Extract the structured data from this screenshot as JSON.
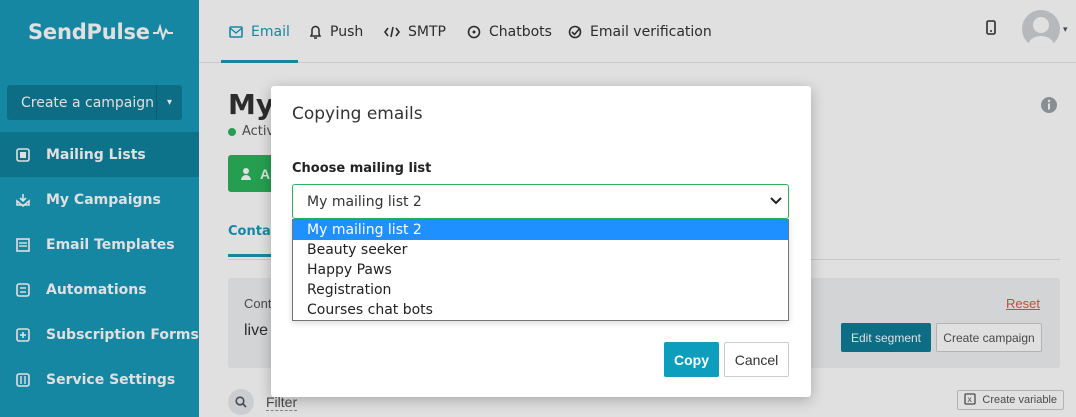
{
  "app": {
    "logo": "SendPulse"
  },
  "sidebar": {
    "create_label": "Create a campaign",
    "items": [
      {
        "label": "Mailing Lists",
        "icon": "list-icon"
      },
      {
        "label": "My Campaigns",
        "icon": "campaign-icon"
      },
      {
        "label": "Email Templates",
        "icon": "template-icon"
      },
      {
        "label": "Automations",
        "icon": "automation-icon"
      },
      {
        "label": "Subscription Forms",
        "icon": "form-icon"
      },
      {
        "label": "Service Settings",
        "icon": "settings-icon"
      }
    ]
  },
  "topnav": {
    "tabs": [
      {
        "label": "Email",
        "icon": "email-icon"
      },
      {
        "label": "Push",
        "icon": "bell-icon"
      },
      {
        "label": "SMTP",
        "icon": "code-icon"
      },
      {
        "label": "Chatbots",
        "icon": "chat-icon"
      },
      {
        "label": "Email verification",
        "icon": "check-circle-icon"
      }
    ]
  },
  "main": {
    "title": "My",
    "status": "Activ",
    "add_button": "A",
    "tab": "Conta",
    "segment": {
      "label": "Cont",
      "value": "live",
      "reset": "Reset",
      "edit_segment": "Edit segment",
      "create_campaign": "Create campaign"
    },
    "filter": "Filter",
    "create_variable": "Create variable"
  },
  "modal": {
    "title": "Copying emails",
    "field_label": "Choose mailing list",
    "selected": "My mailing list 2",
    "options": [
      "My mailing list 2",
      "Beauty seeker",
      "Happy Paws",
      "Registration",
      "Courses chat bots"
    ],
    "copy": "Copy",
    "cancel": "Cancel"
  },
  "colors": {
    "brand": "#1a9aba",
    "sidebar_active": "#0f839e",
    "success": "#2bb55b",
    "option_highlight": "#1e90ff",
    "reset": "#e0593f"
  }
}
